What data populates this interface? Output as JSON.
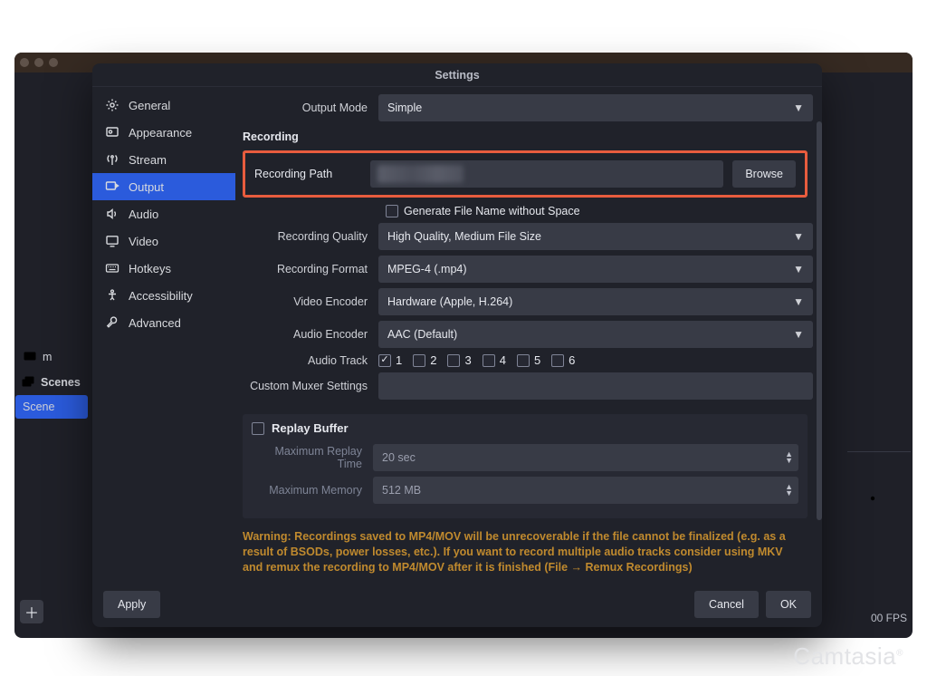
{
  "window_title": "Settings",
  "sidebar": {
    "items": [
      {
        "label": "General",
        "icon": "gear"
      },
      {
        "label": "Appearance",
        "icon": "appearance"
      },
      {
        "label": "Stream",
        "icon": "antenna"
      },
      {
        "label": "Output",
        "icon": "output"
      },
      {
        "label": "Audio",
        "icon": "speaker"
      },
      {
        "label": "Video",
        "icon": "monitor"
      },
      {
        "label": "Hotkeys",
        "icon": "keyboard"
      },
      {
        "label": "Accessibility",
        "icon": "accessibility"
      },
      {
        "label": "Advanced",
        "icon": "wrench"
      }
    ],
    "active_index": 3
  },
  "output_mode": {
    "label": "Output Mode",
    "value": "Simple"
  },
  "recording": {
    "section": "Recording",
    "path_label": "Recording Path",
    "browse": "Browse",
    "generate_filename": {
      "label": "Generate File Name without Space",
      "checked": false
    },
    "quality": {
      "label": "Recording Quality",
      "value": "High Quality, Medium File Size"
    },
    "format": {
      "label": "Recording Format",
      "value": "MPEG-4 (.mp4)"
    },
    "vencoder": {
      "label": "Video Encoder",
      "value": "Hardware (Apple, H.264)"
    },
    "aencoder": {
      "label": "Audio Encoder",
      "value": "AAC (Default)"
    },
    "audio_track": {
      "label": "Audio Track",
      "options": [
        "1",
        "2",
        "3",
        "4",
        "5",
        "6"
      ],
      "checked": [
        true,
        false,
        false,
        false,
        false,
        false
      ]
    },
    "muxer": {
      "label": "Custom Muxer Settings",
      "value": ""
    }
  },
  "replay_buffer": {
    "title": "Replay Buffer",
    "checked": false,
    "max_time": {
      "label": "Maximum Replay Time",
      "value": "20 sec"
    },
    "max_mem": {
      "label": "Maximum Memory",
      "value": "512 MB"
    }
  },
  "warning_text": "Warning: Recordings saved to MP4/MOV will be unrecoverable if the file cannot be finalized (e.g. as a result of BSODs, power losses, etc.). If you want to record multiple audio tracks consider using MKV and remux the recording to MP4/MOV after it is finished (File → Remux Recordings)",
  "buttons": {
    "apply": "Apply",
    "cancel": "Cancel",
    "ok": "OK"
  },
  "background": {
    "scenes_header": "Scenes",
    "scene_item": "Scene",
    "mon_row": "m",
    "fps_label": "00 FPS"
  },
  "watermark": "Camtasia"
}
